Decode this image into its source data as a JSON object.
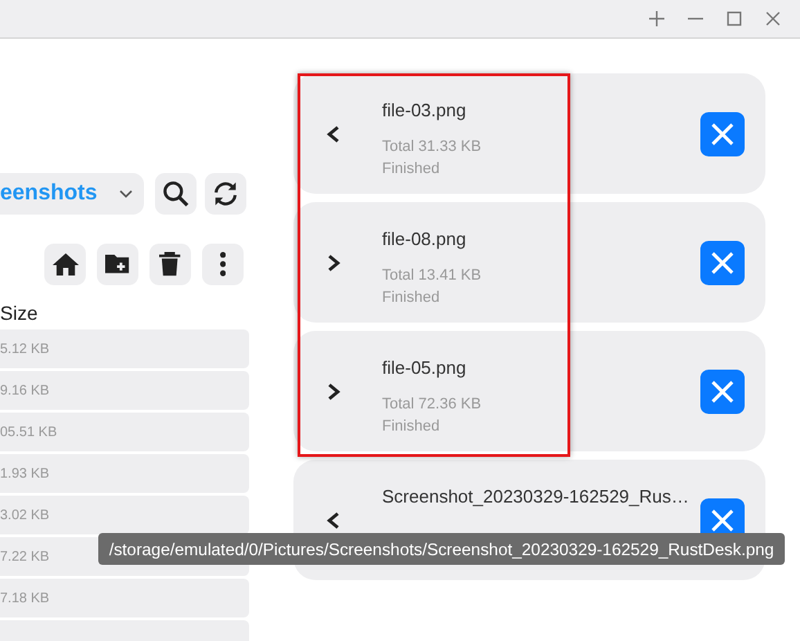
{
  "path_dropdown": {
    "value": "eenshots"
  },
  "file_list": {
    "column": "Size",
    "rows": [
      {
        "size": "5.12 KB"
      },
      {
        "size": "9.16 KB"
      },
      {
        "size": "05.51 KB"
      },
      {
        "size": "1.93 KB"
      },
      {
        "size": "3.02 KB"
      },
      {
        "size": "7.22 KB"
      },
      {
        "size": "7.18 KB"
      },
      {}
    ]
  },
  "transfers": [
    {
      "name": "file-03.png",
      "total": "Total 31.33 KB",
      "status": "Finished",
      "kind": "left"
    },
    {
      "name": "file-08.png",
      "total": "Total 13.41 KB",
      "status": "Finished",
      "kind": "right"
    },
    {
      "name": "file-05.png",
      "total": "Total 72.36 KB",
      "status": "Finished",
      "kind": "right"
    },
    {
      "name": "Screenshot_20230329-162529_Rus…",
      "kind": "left"
    }
  ],
  "tooltip": "/storage/emulated/0/Pictures/Screenshots/Screenshot_20230329-162529_RustDesk.png"
}
